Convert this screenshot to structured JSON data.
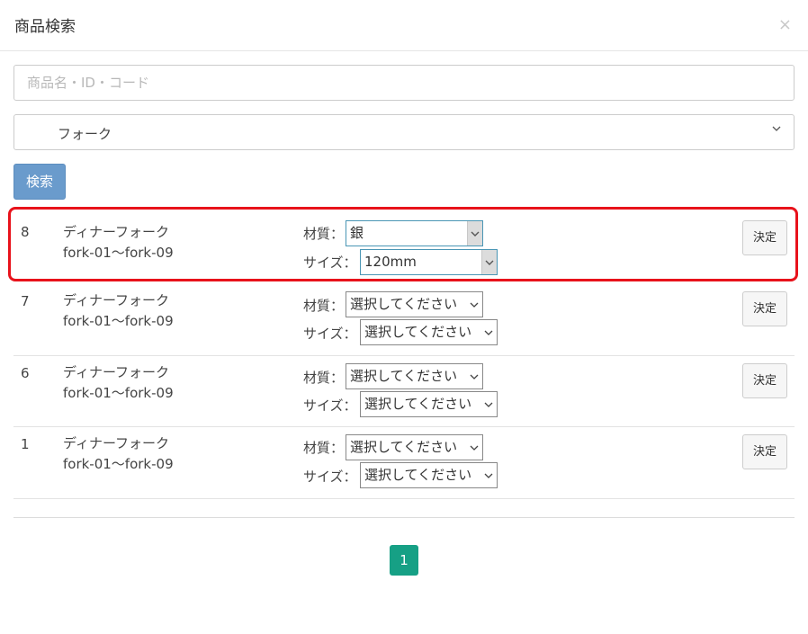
{
  "header": {
    "title": "商品検索",
    "close_glyph": "×"
  },
  "search": {
    "placeholder": "商品名・ID・コード",
    "value": ""
  },
  "category": {
    "selected": "フォーク"
  },
  "search_button_label": "検索",
  "labels": {
    "material": "材質：",
    "size": "サイズ：",
    "decide": "決定"
  },
  "rows": [
    {
      "number": "8",
      "name": "ディナーフォーク",
      "code": "fork-01〜fork-09",
      "material": "銀",
      "size": "120mm"
    },
    {
      "number": "7",
      "name": "ディナーフォーク",
      "code": "fork-01〜fork-09",
      "material": "選択してください",
      "size": "選択してください"
    },
    {
      "number": "6",
      "name": "ディナーフォーク",
      "code": "fork-01〜fork-09",
      "material": "選択してください",
      "size": "選択してください"
    },
    {
      "number": "1",
      "name": "ディナーフォーク",
      "code": "fork-01〜fork-09",
      "material": "選択してください",
      "size": "選択してください"
    }
  ],
  "pagination": {
    "current": "1"
  },
  "colors": {
    "primary_button": "#6a9bcc",
    "page_active": "#16a085",
    "highlight": "#e8121b"
  }
}
